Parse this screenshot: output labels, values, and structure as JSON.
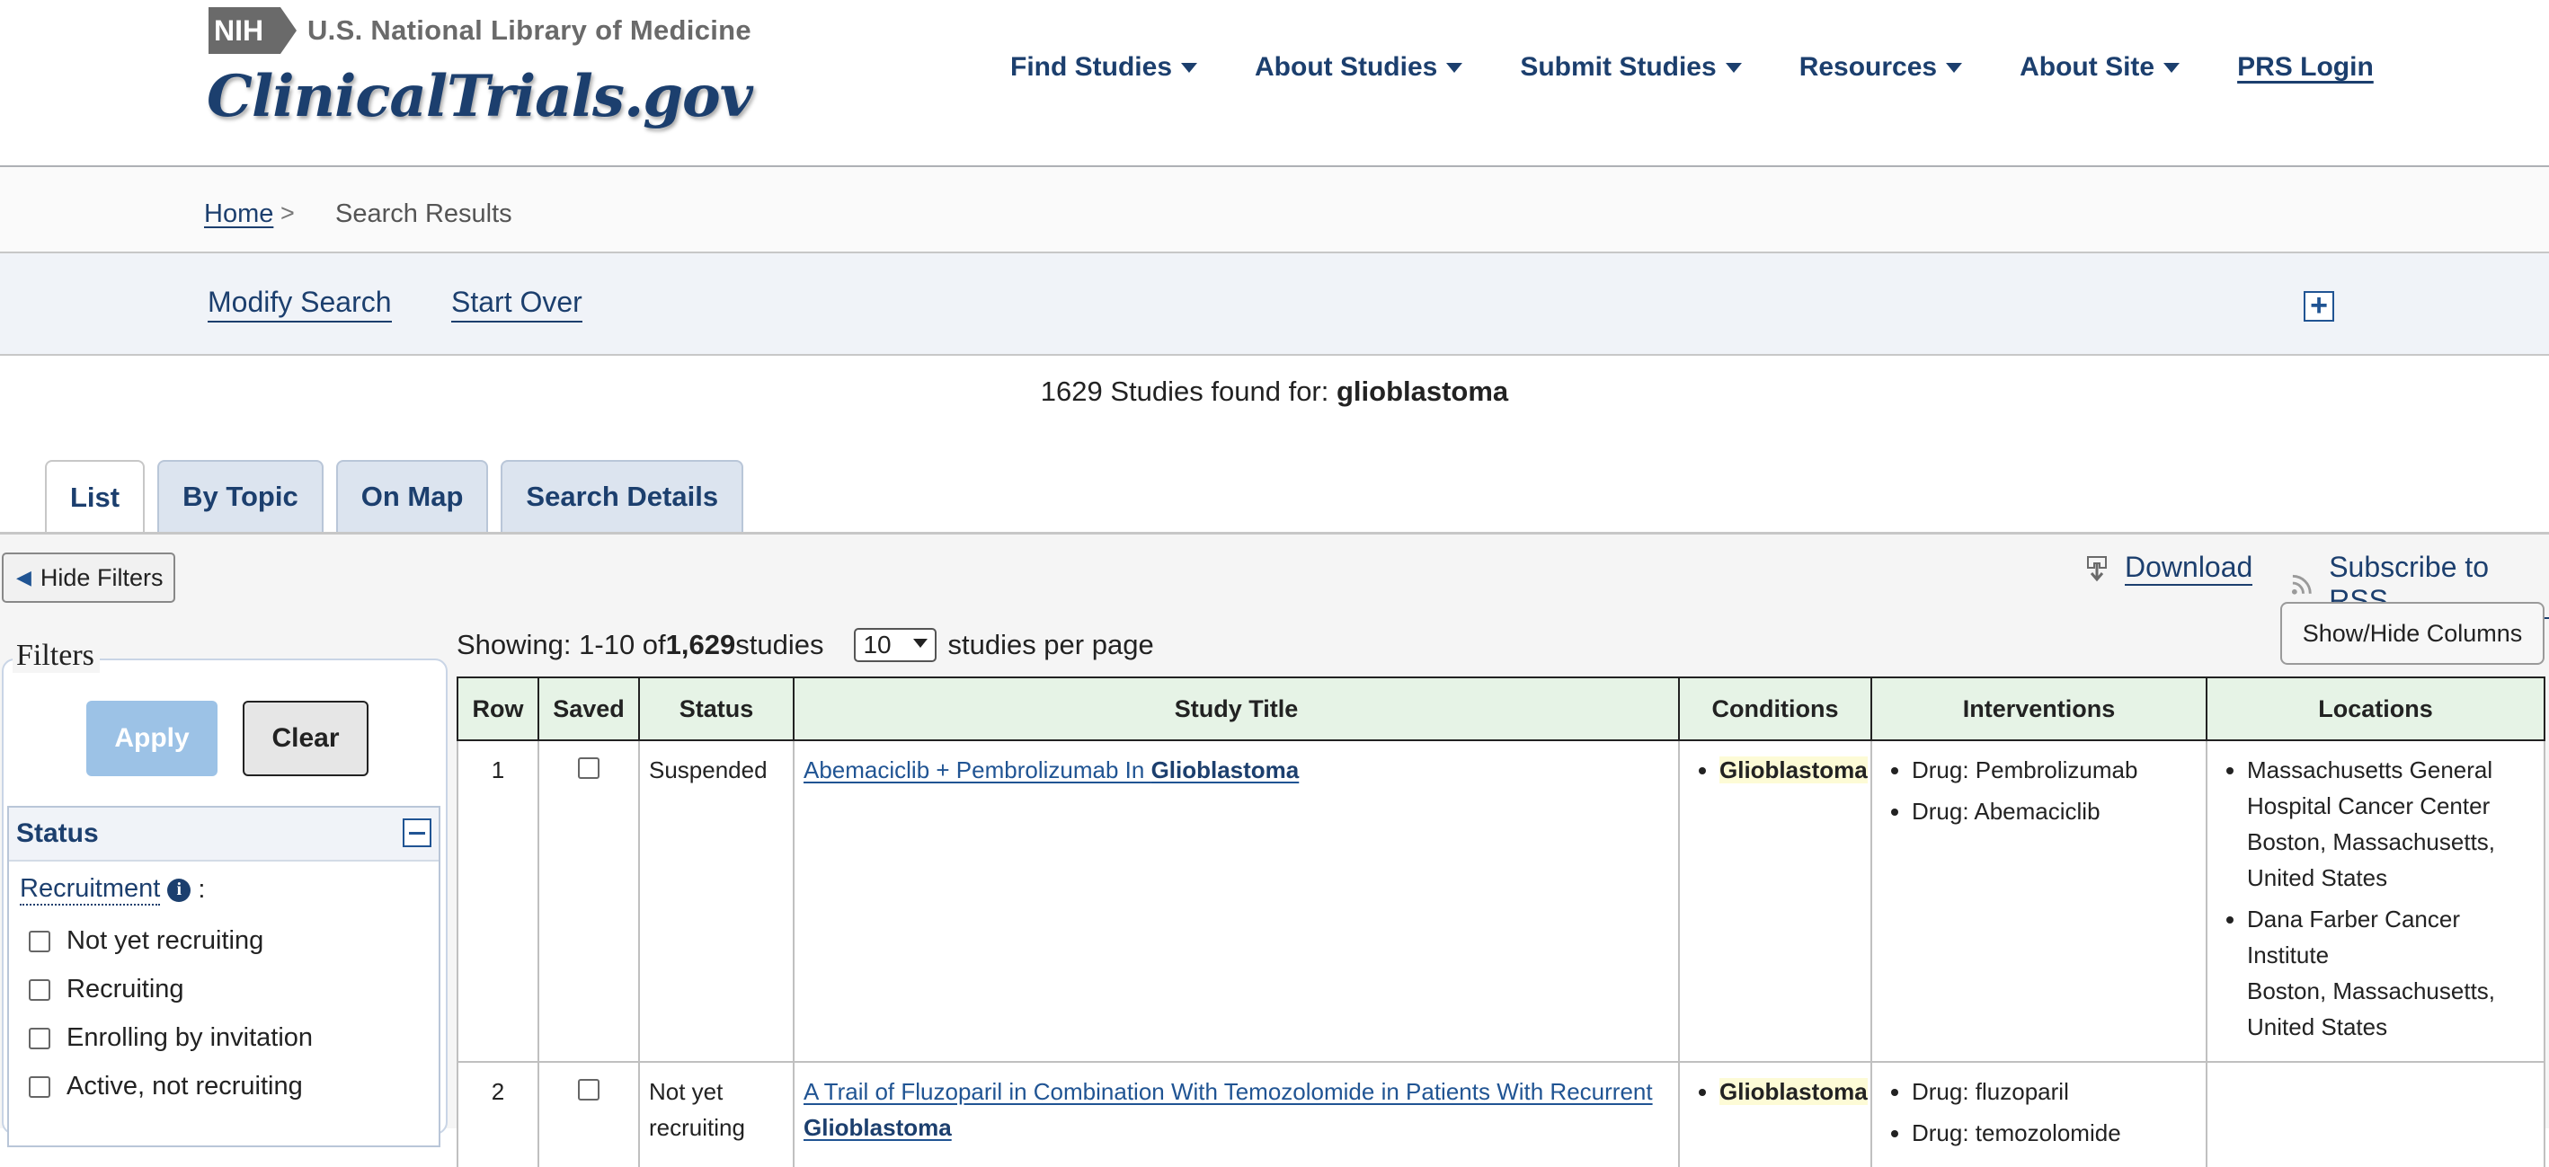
{
  "header": {
    "nih_badge": "NIH",
    "nlm_title": "U.S. National Library of Medicine",
    "site_title": "ClinicalTrials.gov",
    "nav": [
      {
        "label": "Find Studies"
      },
      {
        "label": "About Studies"
      },
      {
        "label": "Submit Studies"
      },
      {
        "label": "Resources"
      },
      {
        "label": "About Site"
      }
    ],
    "login_label": "PRS Login"
  },
  "breadcrumb": {
    "home": "Home",
    "separator": ">",
    "current": "Search Results"
  },
  "search_bar": {
    "modify": "Modify Search",
    "start_over": "Start Over",
    "expand_icon": "plus-box-icon",
    "expand_symbol": "+"
  },
  "summary": {
    "count": "1629",
    "prefix_text": " Studies found for: ",
    "query": "glioblastoma"
  },
  "tabs": [
    {
      "label": "List",
      "active": true
    },
    {
      "label": "By Topic",
      "active": false
    },
    {
      "label": "On Map",
      "active": false
    },
    {
      "label": "Search Details",
      "active": false
    }
  ],
  "toolbar": {
    "hide_filters": "Hide Filters",
    "hide_filters_arrow": "◀",
    "download": "Download",
    "rss": "Subscribe to RSS",
    "show_hide_columns": "Show/Hide Columns"
  },
  "paging": {
    "showing_prefix": "Showing: 1-10 of ",
    "total": "1,629",
    "showing_suffix": " studies",
    "per_page_value": "10",
    "per_page_suffix": "studies per page"
  },
  "filters": {
    "legend": "Filters",
    "apply": "Apply",
    "clear": "Clear",
    "status_title": "Status",
    "recruitment_label": "Recruitment",
    "recruitment_info": "i",
    "recruitment_colon": ":",
    "options": [
      "Not yet recruiting",
      "Recruiting",
      "Enrolling by invitation",
      "Active, not recruiting"
    ]
  },
  "table": {
    "columns": [
      "Row",
      "Saved",
      "Status",
      "Study Title",
      "Conditions",
      "Interventions",
      "Locations"
    ],
    "rows": [
      {
        "row": "1",
        "status": "Suspended",
        "title_prefix": "Abemaciclib + Pembrolizumab In ",
        "title_highlight": "Glioblastoma",
        "condition": "Glioblastoma",
        "interventions": [
          "Drug: Pembrolizumab",
          "Drug: Abemaciclib"
        ],
        "locations": [
          {
            "name": "Massachusetts General Hospital Cancer Center",
            "place": "Boston, Massachusetts, United States"
          },
          {
            "name": "Dana Farber Cancer Institute",
            "place": "Boston, Massachusetts, United States"
          }
        ]
      },
      {
        "row": "2",
        "status": "Not yet recruiting",
        "title_prefix": "A Trail of Fluzoparil in Combination With Temozolomide in Patients With Recurrent ",
        "title_highlight": "Glioblastoma",
        "condition": "Glioblastoma",
        "interventions": [
          "Drug: fluzoparil",
          "Drug: temozolomide"
        ]
      }
    ]
  }
}
